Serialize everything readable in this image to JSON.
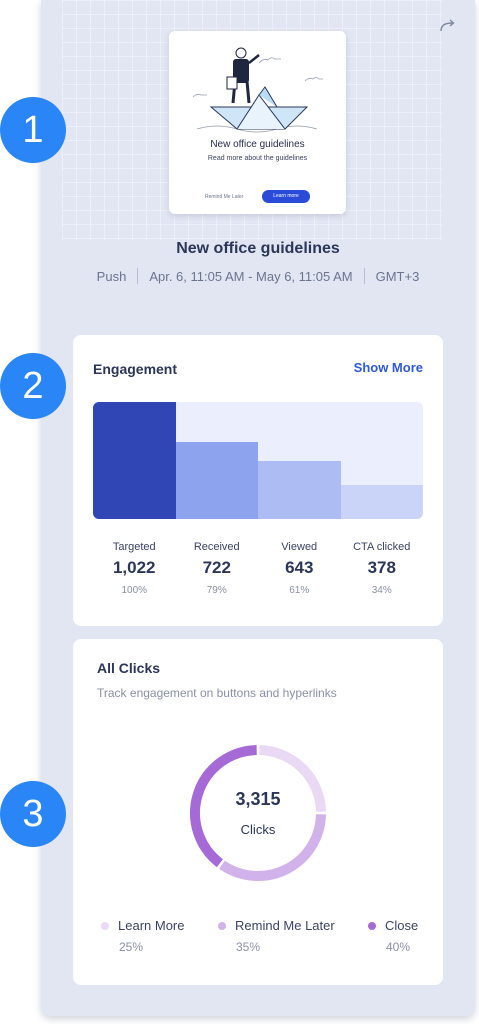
{
  "preview": {
    "title": "New office guidelines",
    "subtitle": "Read more about the guidelines",
    "remind_label": "Remind Me Later",
    "learn_label": "Learn more"
  },
  "header": {
    "title": "New office guidelines",
    "type": "Push",
    "date_range": "Apr. 6, 11:05 AM - May 6, 11:05 AM",
    "timezone": "GMT+3"
  },
  "badges": [
    "1",
    "2",
    "3"
  ],
  "engagement": {
    "title": "Engagement",
    "show_more": "Show More",
    "stats": [
      {
        "label": "Targeted",
        "value": "1,022",
        "pct": "100%",
        "color": "#2f46b4",
        "fraction": 1.0
      },
      {
        "label": "Received",
        "value": "722",
        "pct": "79%",
        "color": "#8ea3ee",
        "fraction": 0.66
      },
      {
        "label": "Viewed",
        "value": "643",
        "pct": "61%",
        "color": "#adbcf3",
        "fraction": 0.5
      },
      {
        "label": "CTA clicked",
        "value": "378",
        "pct": "34%",
        "color": "#cad4f8",
        "fraction": 0.29
      }
    ]
  },
  "all_clicks": {
    "title": "All Clicks",
    "subtitle": "Track engagement on buttons and hyperlinks",
    "total": "3,315",
    "unit": "Clicks",
    "items": [
      {
        "label": "Learn More",
        "pct": "25%",
        "share": 25,
        "color": "#ead9f4"
      },
      {
        "label": "Remind Me Later",
        "pct": "35%",
        "share": 35,
        "color": "#d2b2ea"
      },
      {
        "label": "Close",
        "pct": "40%",
        "share": 40,
        "color": "#a66ad6"
      }
    ]
  },
  "colors": {
    "accent": "#2e5ad6",
    "badge": "#2a86f6",
    "panel_bg": "#e2e6f2"
  }
}
